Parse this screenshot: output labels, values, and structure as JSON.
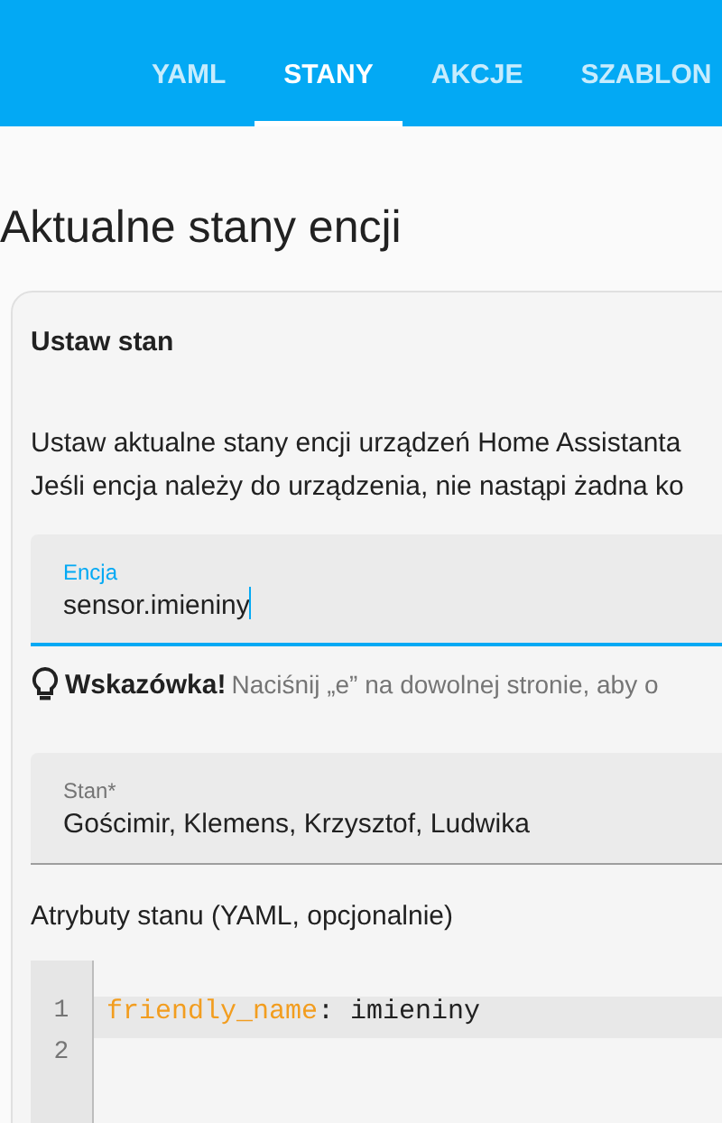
{
  "tabs": [
    {
      "label": "YAML",
      "selected": false
    },
    {
      "label": "STANY",
      "selected": true
    },
    {
      "label": "AKCJE",
      "selected": false
    },
    {
      "label": "SZABLON",
      "selected": false
    }
  ],
  "page_title": "Aktualne stany encji",
  "card": {
    "title": "Ustaw stan",
    "description": [
      "Ustaw aktualne stany encji urządzeń Home Assistanta",
      "Jeśli encja należy do urządzenia, nie nastąpi żadna ko"
    ],
    "entity_field": {
      "label": "Encja",
      "value": "sensor.imieniny",
      "focused": true
    },
    "tip": {
      "title": "Wskazówka!",
      "text": "Naciśnij „e” na dowolnej stronie, aby o"
    },
    "state_field": {
      "label": "Stan*",
      "value": "Gościmir, Klemens, Krzysztof, Ludwika",
      "focused": false
    },
    "attributes_label": "Atrybuty stanu (YAML, opcjonalnie)",
    "code_lines": [
      {
        "number": "1",
        "active": true,
        "tokens": [
          {
            "kind": "key",
            "text": "friendly_name"
          },
          {
            "kind": "plain",
            "text": ": imieniny"
          }
        ]
      },
      {
        "number": "2",
        "active": false
      }
    ]
  }
}
